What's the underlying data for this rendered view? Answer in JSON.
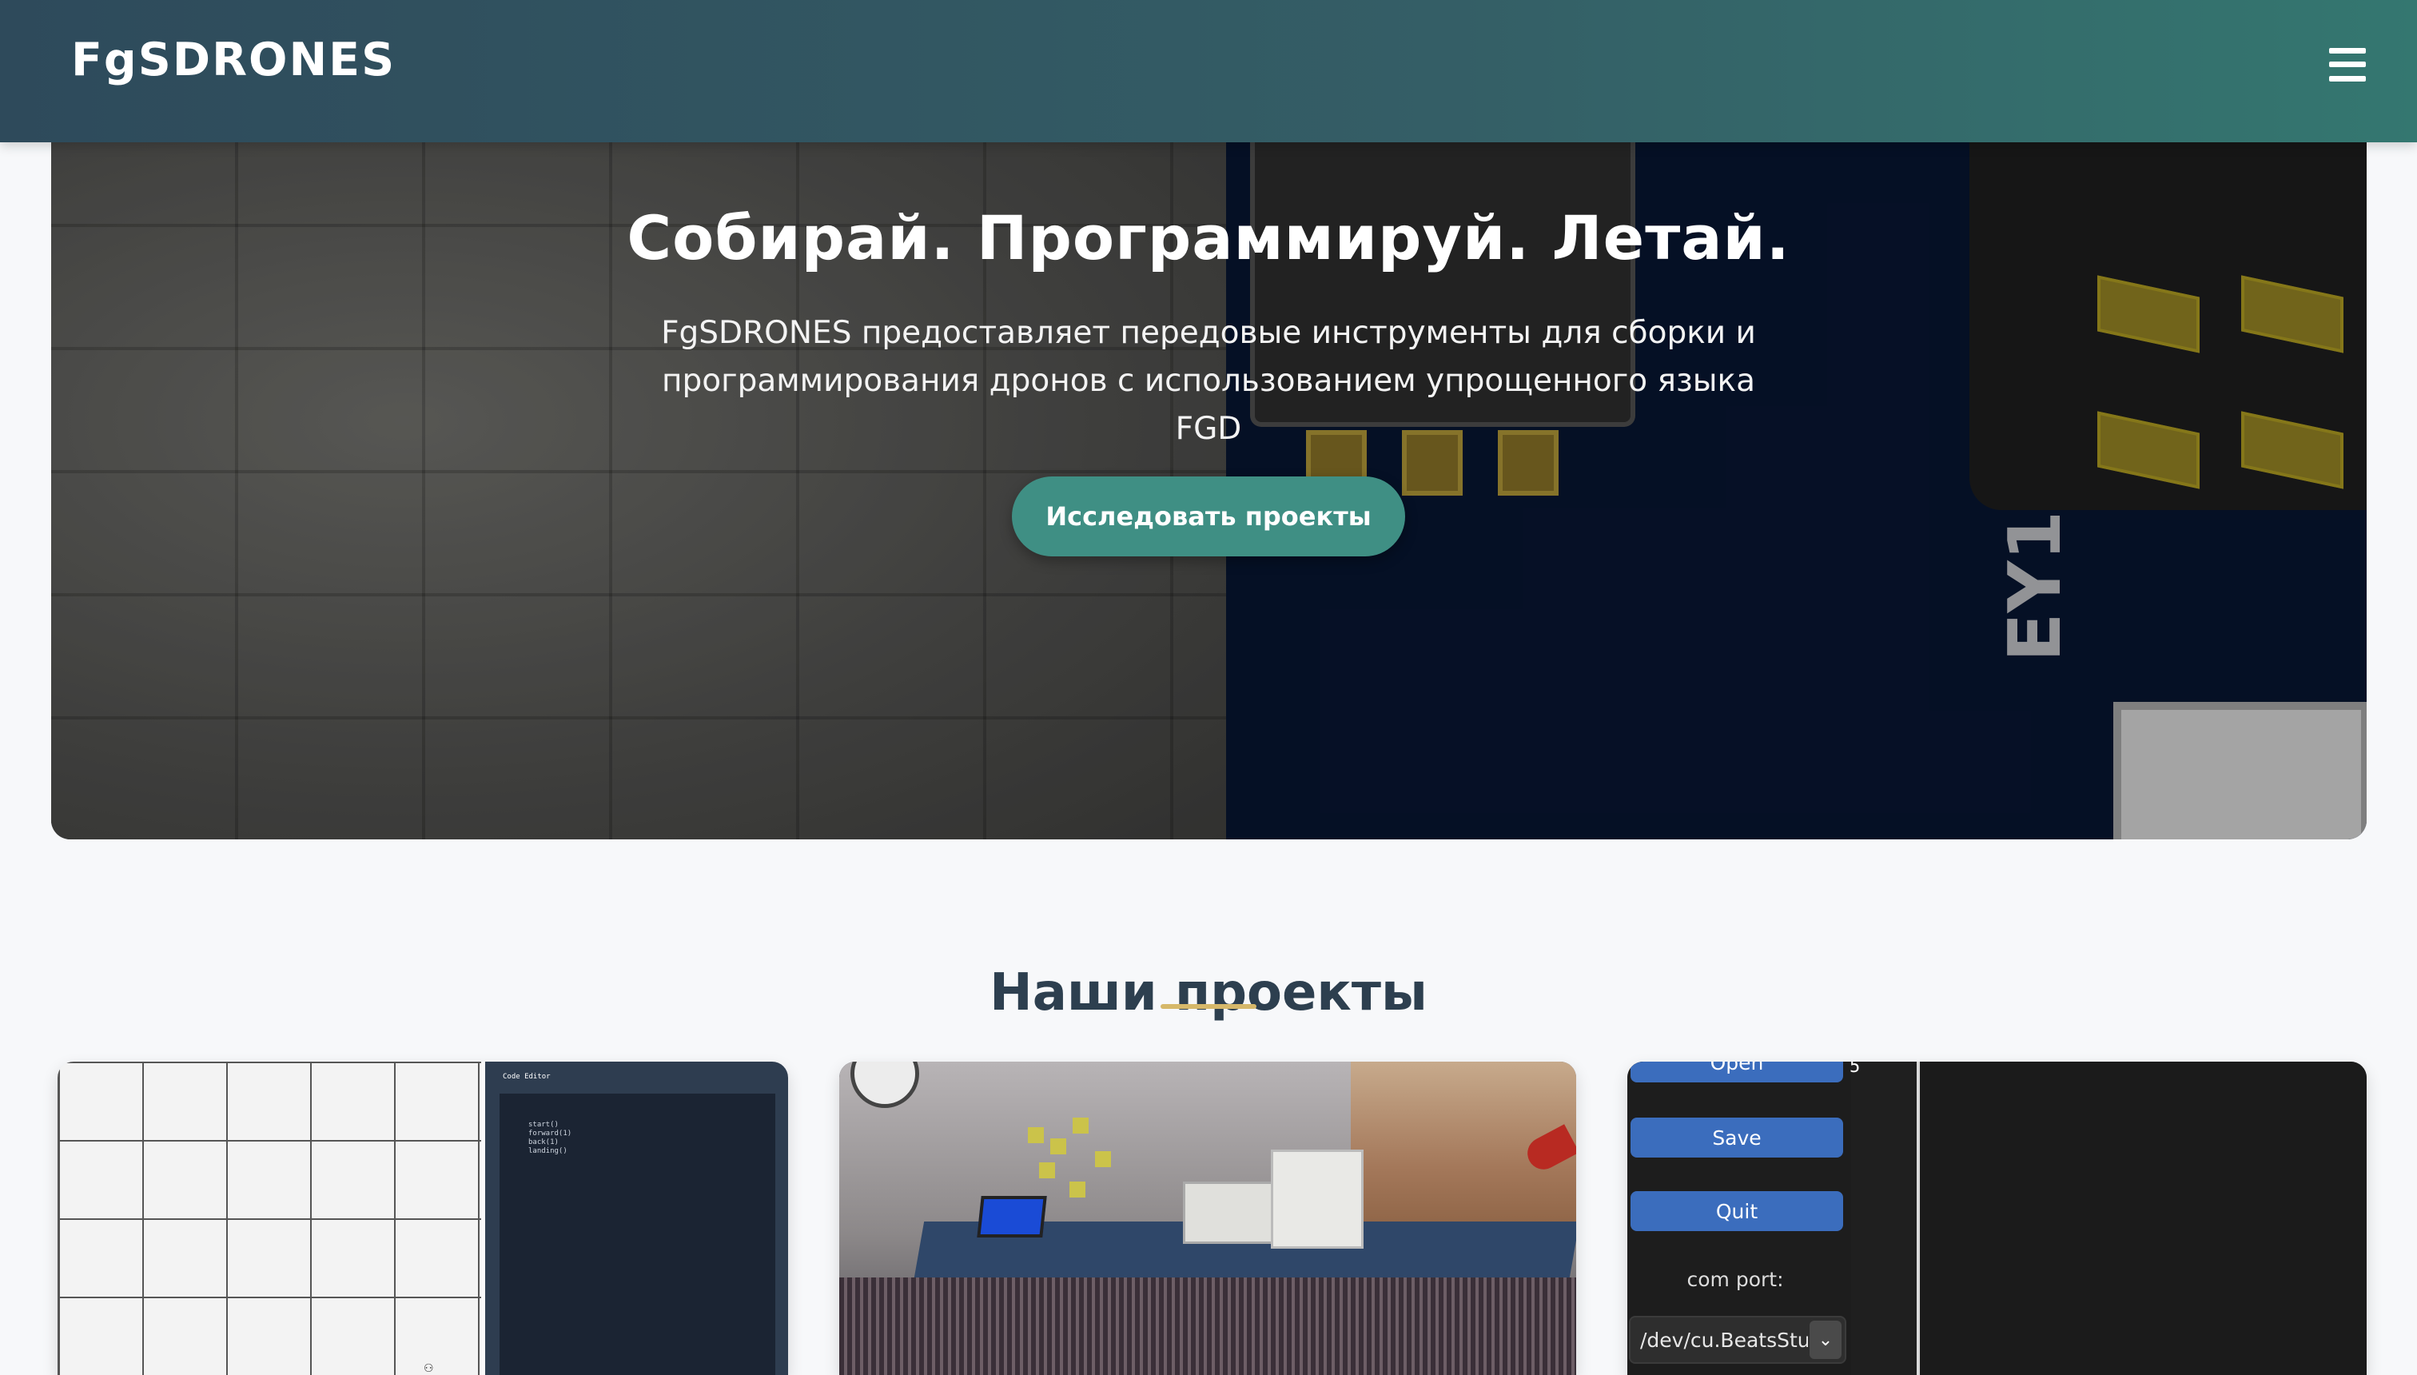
{
  "navbar": {
    "brand": "FgSDRONES",
    "menu_icon": "hamburger-menu-icon"
  },
  "hero": {
    "title": "Собирай. Программируй. Летай.",
    "subtitle": "FgSDRONES предоставляет передовые инструменты для сборки и программирования дронов с использованием упрощенного языка FGD",
    "cta_label": "Исследовать проекты",
    "background_text": "EY1"
  },
  "projects": {
    "title": "Наши проекты",
    "cards": [
      {
        "editor_title": "Code Editor",
        "editor_code": "start()\nforward(1)\nback(1)\nlanding()"
      },
      {
        "scene": "3d-room"
      },
      {
        "buttons": [
          "Open",
          "Save",
          "Quit"
        ],
        "com_label": "com port:",
        "com_value": "/dev/cu.BeatsStudio",
        "console_line": "5"
      }
    ]
  },
  "colors": {
    "navbar_start": "#2e4a5b",
    "navbar_end": "#347770",
    "accent": "#3f8f84",
    "underline": "#d6b86a",
    "heading": "#2d3f4f",
    "button_blue": "#3b6dbd"
  }
}
